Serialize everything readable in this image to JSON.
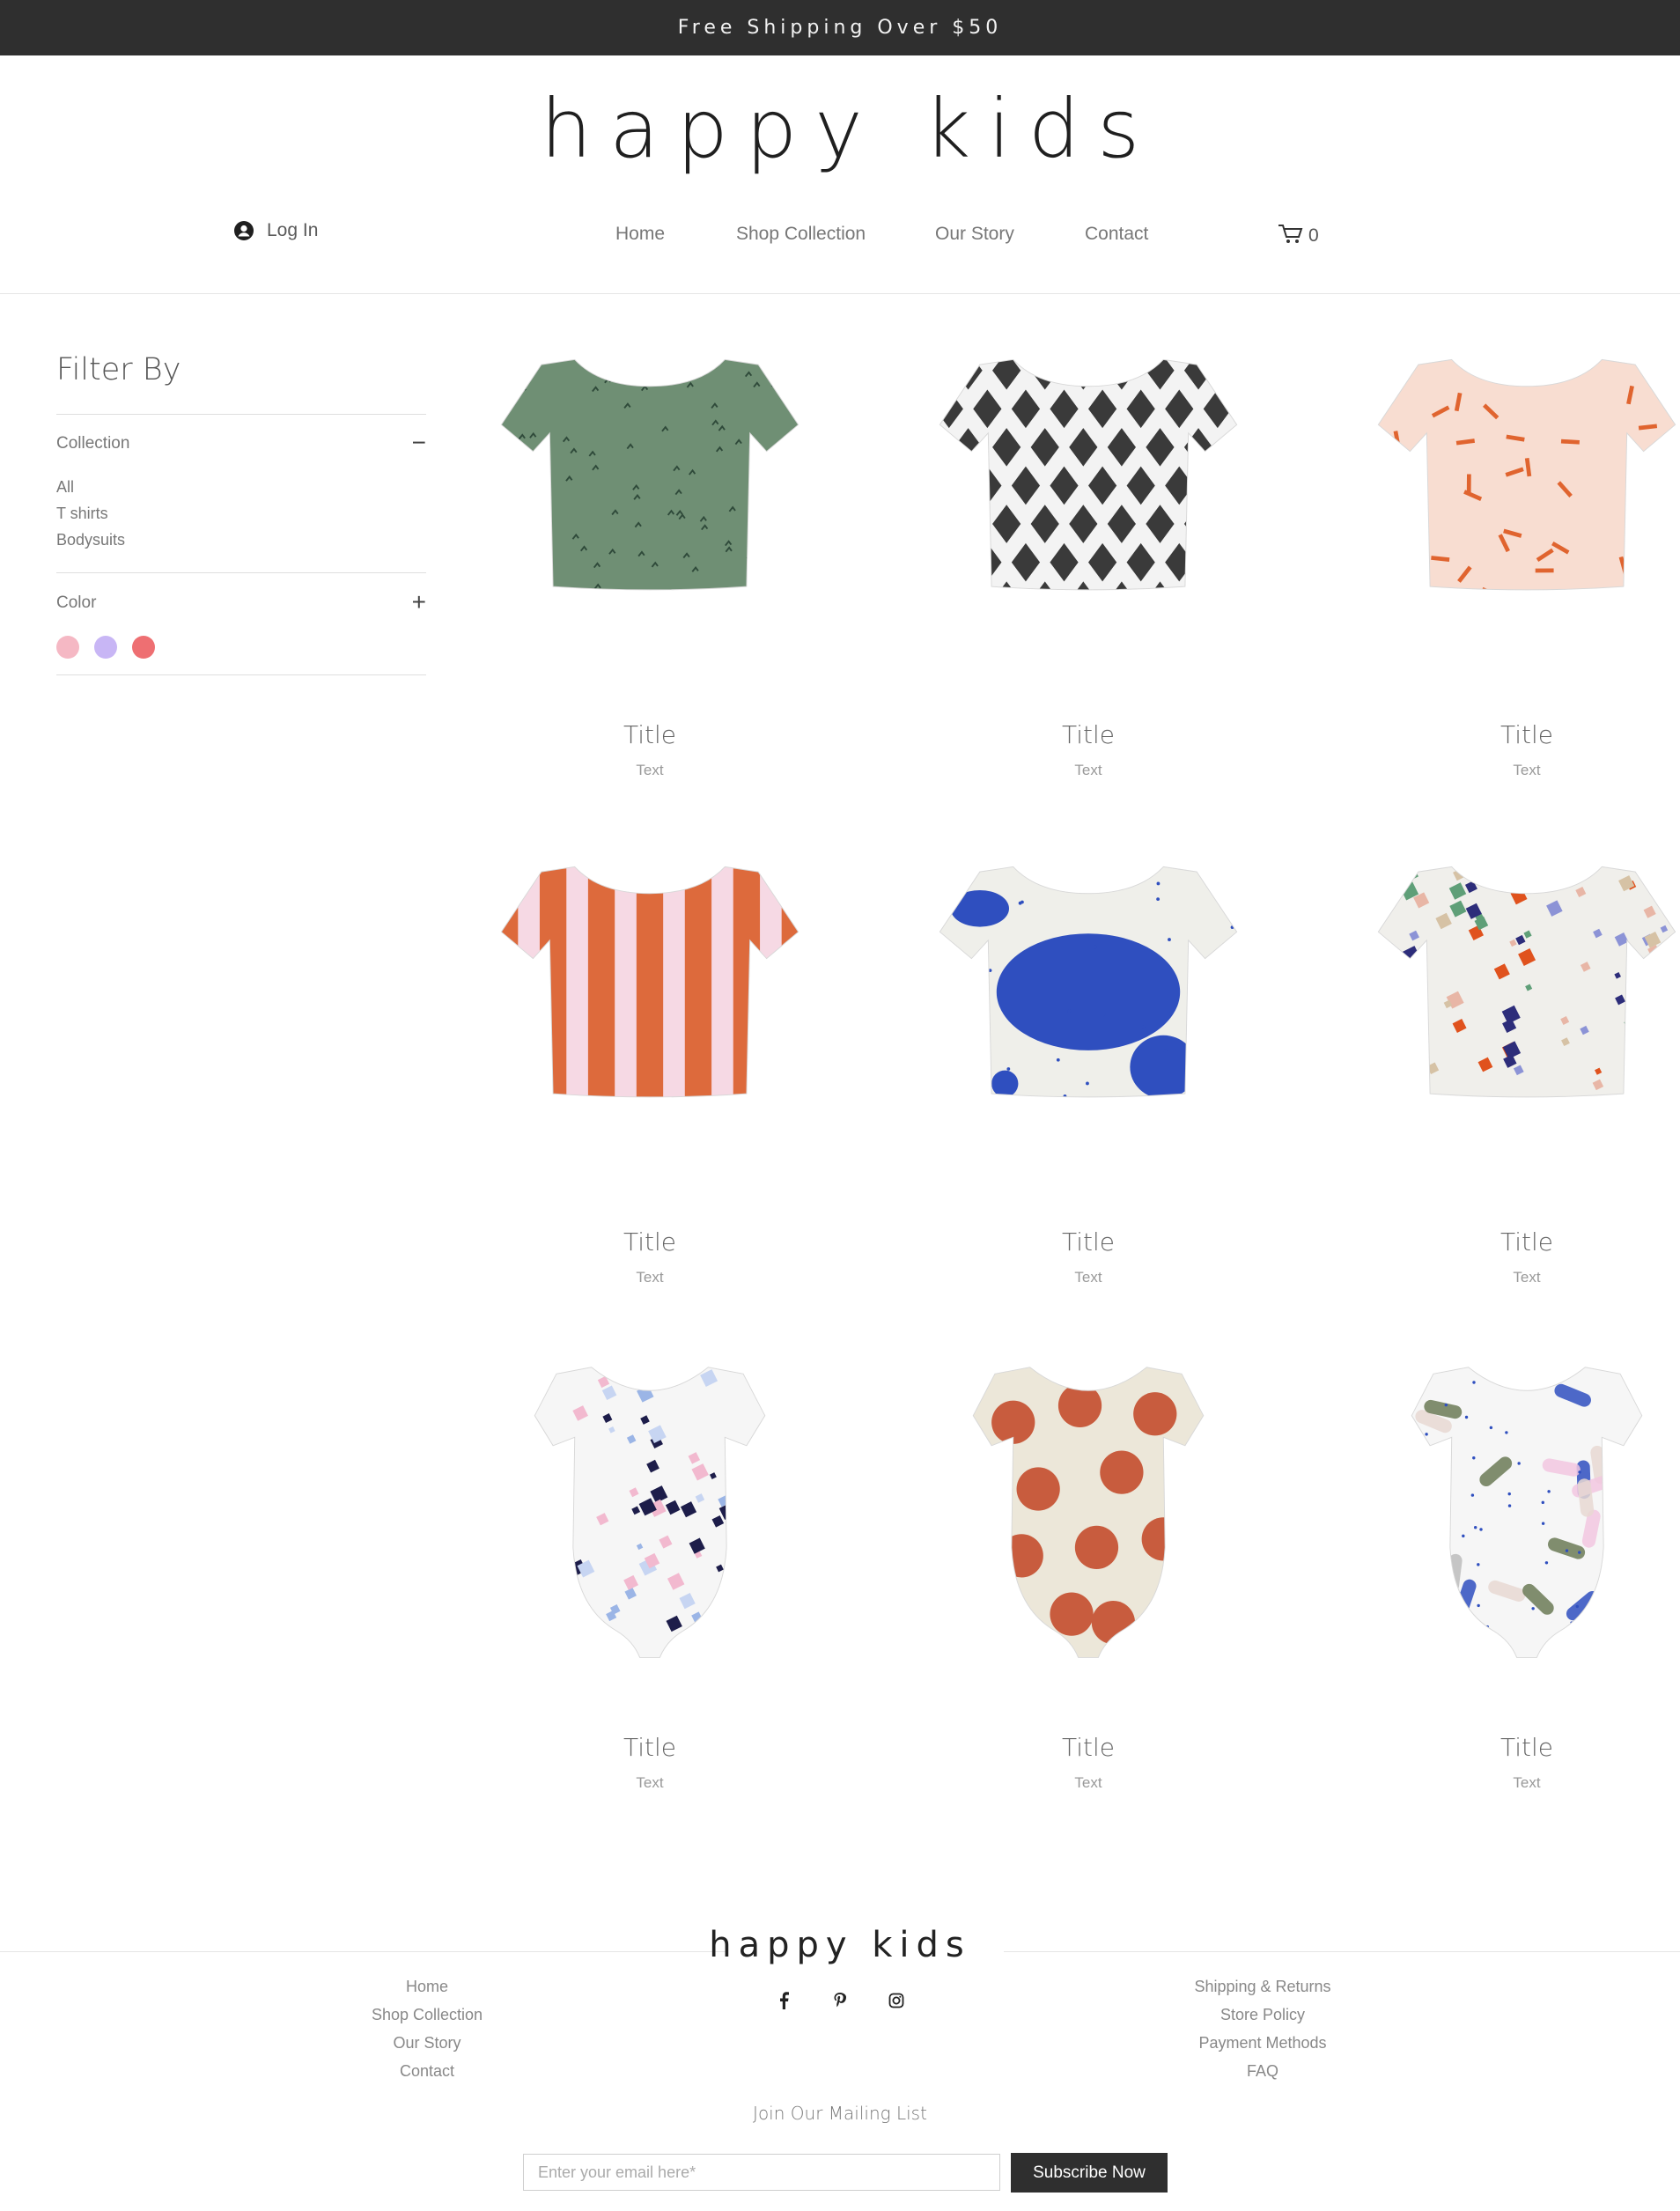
{
  "announcement": "Free Shipping Over $50",
  "brand": {
    "logo": "happy kids"
  },
  "header": {
    "login_label": "Log In",
    "nav": [
      "Home",
      "Shop Collection",
      "Our Story",
      "Contact"
    ],
    "cart_count": "0"
  },
  "filter": {
    "title": "Filter By",
    "collection": {
      "label": "Collection",
      "toggle": "−",
      "options": [
        "All",
        "T shirts",
        "Bodysuits"
      ]
    },
    "color": {
      "label": "Color",
      "toggle": "+",
      "swatches": [
        "#f5b8c4",
        "#c8b6f5",
        "#ee6f72"
      ]
    }
  },
  "products": [
    {
      "title": "Title",
      "text": "Text",
      "kind": "tshirt",
      "pattern": "green-sprigs"
    },
    {
      "title": "Title",
      "text": "Text",
      "kind": "tshirt",
      "pattern": "harlequin"
    },
    {
      "title": "Title",
      "text": "Text",
      "kind": "tshirt",
      "pattern": "peach-sprinkles"
    },
    {
      "title": "Title",
      "text": "Text",
      "kind": "tshirt",
      "pattern": "orange-stripes"
    },
    {
      "title": "Title",
      "text": "Text",
      "kind": "tshirt",
      "pattern": "blue-blobs"
    },
    {
      "title": "Title",
      "text": "Text",
      "kind": "tshirt",
      "pattern": "terrazzo"
    },
    {
      "title": "Title",
      "text": "Text",
      "kind": "bodysuit",
      "pattern": "navy-terrazzo"
    },
    {
      "title": "Title",
      "text": "Text",
      "kind": "bodysuit",
      "pattern": "rust-dots"
    },
    {
      "title": "Title",
      "text": "Text",
      "kind": "bodysuit",
      "pattern": "painterly"
    }
  ],
  "footer": {
    "logo": "happy kids",
    "left_links": [
      "Home",
      "Shop Collection",
      "Our Story",
      "Contact"
    ],
    "right_links": [
      "Shipping & Returns",
      "Store Policy",
      "Payment Methods",
      "FAQ"
    ],
    "social": [
      "facebook-icon",
      "pinterest-icon",
      "instagram-icon"
    ],
    "mailing_title": "Join Our Mailing List",
    "email_placeholder": "Enter your email here*",
    "subscribe_label": "Subscribe Now"
  }
}
